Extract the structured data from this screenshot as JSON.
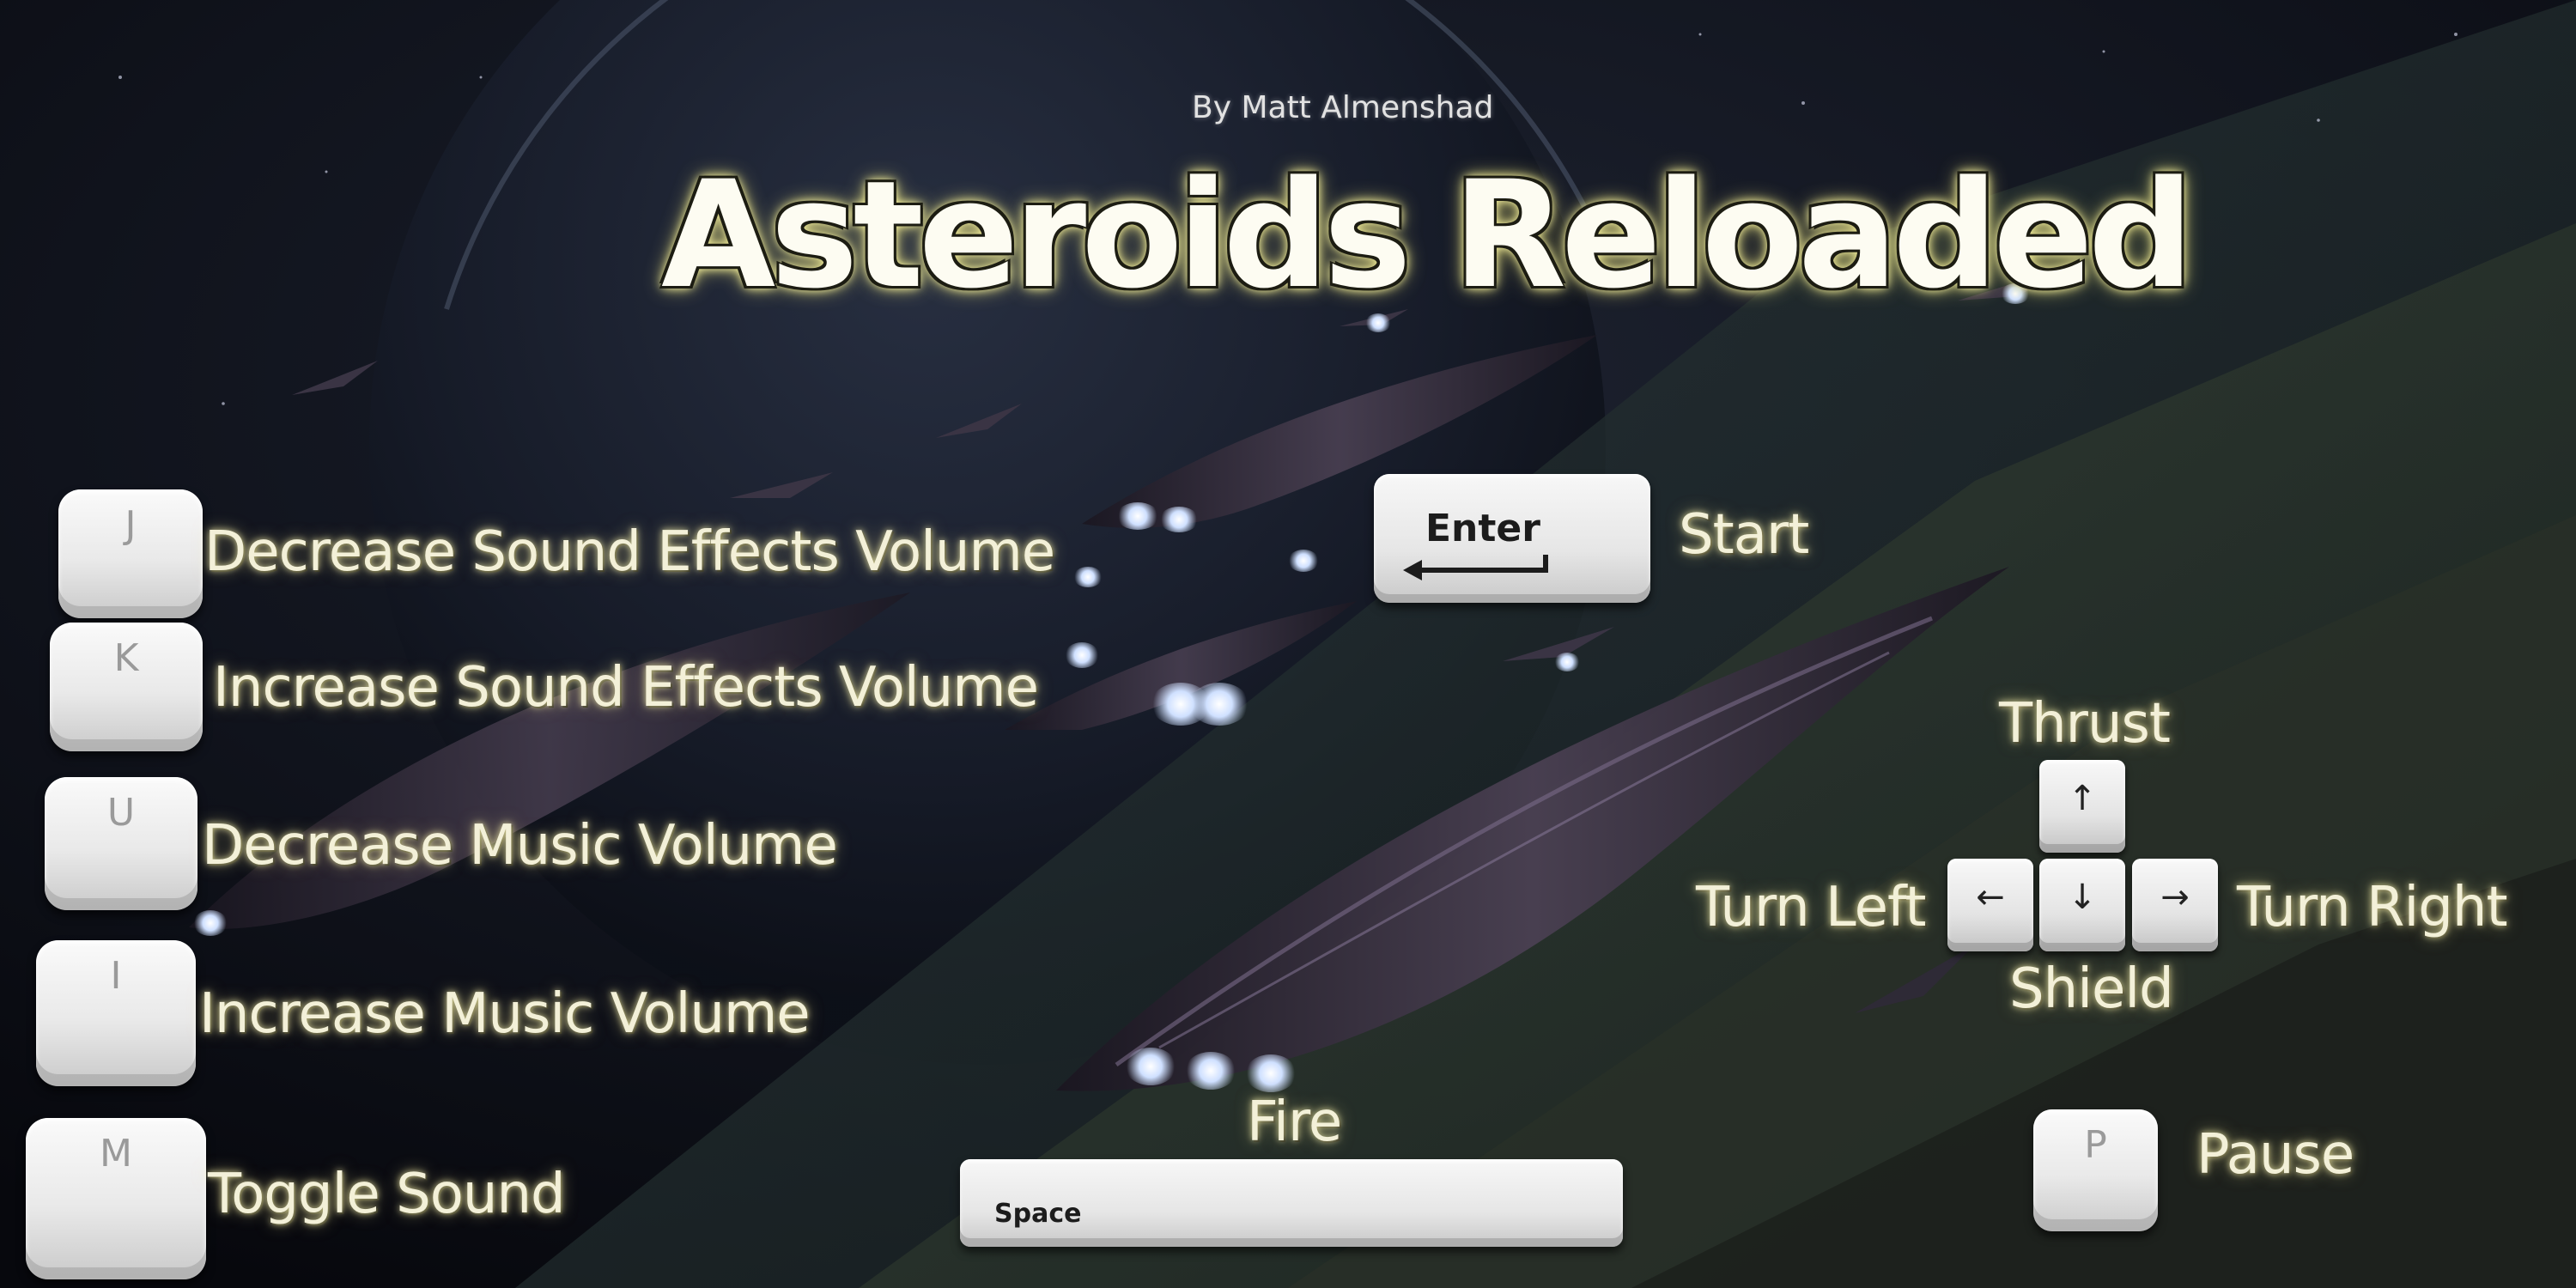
{
  "header": {
    "byline": "By Matt Almenshad",
    "title": "Asteroids Reloaded"
  },
  "left_controls": [
    {
      "key": "J",
      "label": "Decrease Sound Effects Volume"
    },
    {
      "key": "K",
      "label": "Increase Sound Effects Volume"
    },
    {
      "key": "U",
      "label": "Decrease Music Volume"
    },
    {
      "key": "I",
      "label": "Increase Music Volume"
    },
    {
      "key": "M",
      "label": "Toggle Sound"
    }
  ],
  "start": {
    "key": "Enter",
    "label": "Start"
  },
  "fire": {
    "key": "Space",
    "label": "Fire"
  },
  "arrows": {
    "thrust_label": "Thrust",
    "turn_left_label": "Turn Left",
    "turn_right_label": "Turn Right",
    "shield_label": "Shield",
    "up_glyph": "↑",
    "left_glyph": "←",
    "down_glyph": "↓",
    "right_glyph": "→"
  },
  "pause": {
    "key": "P",
    "label": "Pause"
  },
  "colors": {
    "label_text": "#f3f0d8",
    "title_glow": "#f4f0a0",
    "engine_glow": "#cfe0ff"
  }
}
